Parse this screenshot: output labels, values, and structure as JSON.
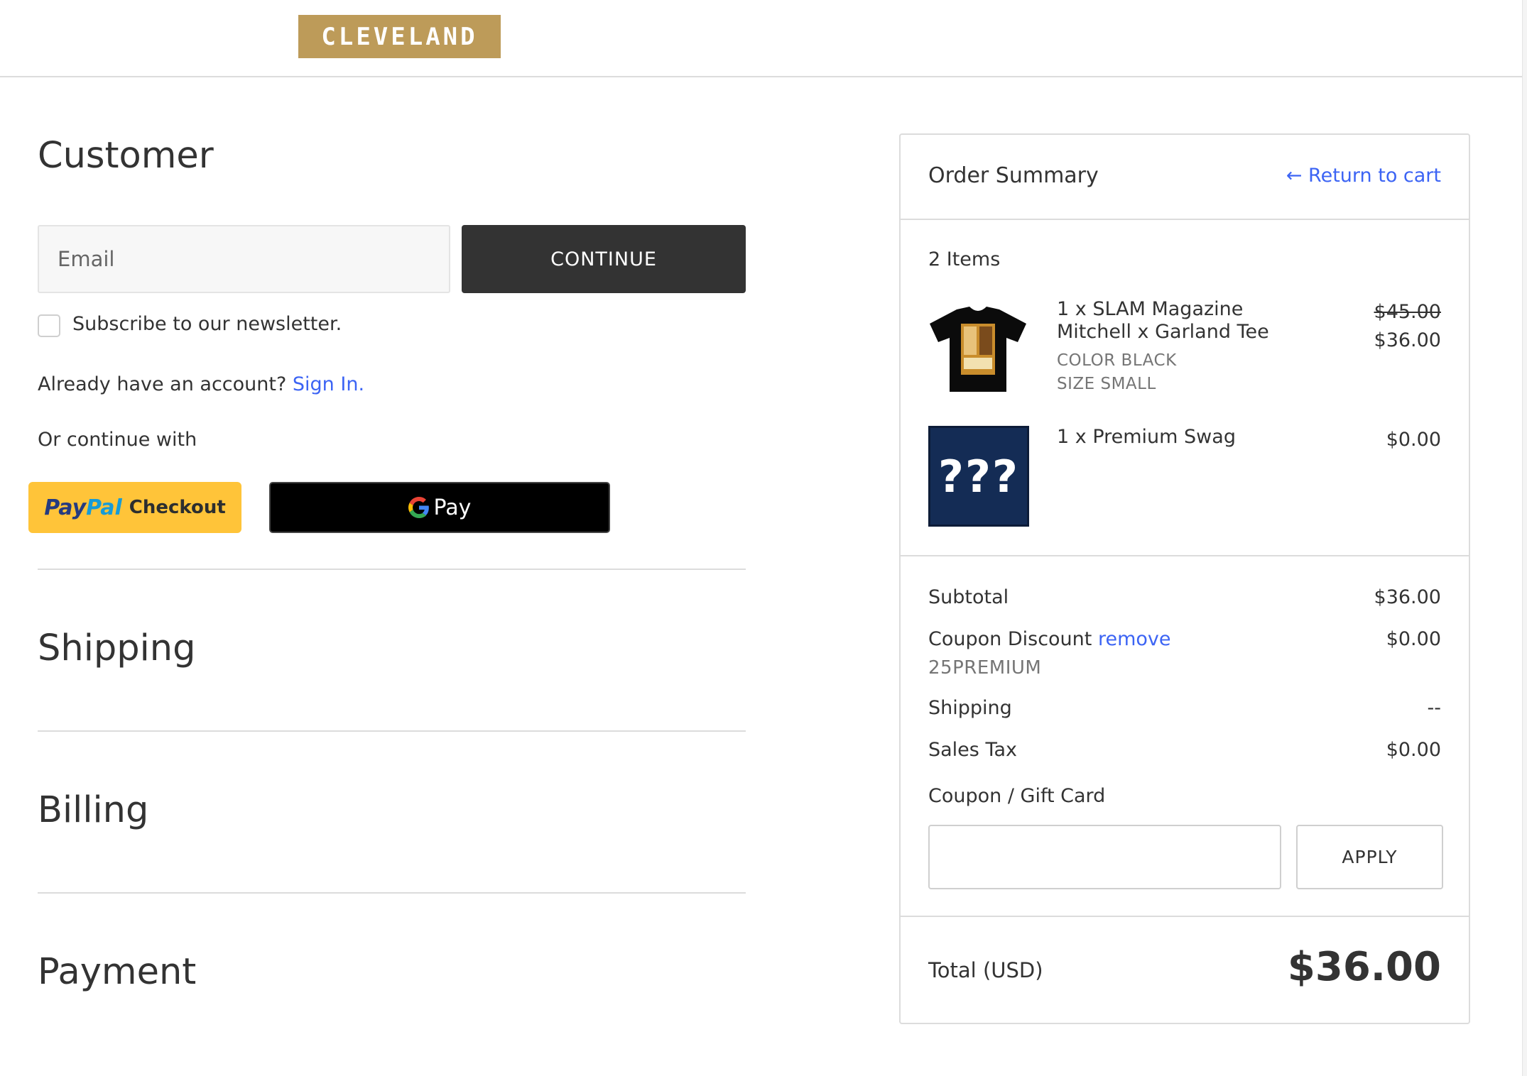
{
  "header": {
    "logo_text": "CLEVELAND"
  },
  "customer": {
    "title": "Customer",
    "email_placeholder": "Email",
    "continue_label": "CONTINUE",
    "newsletter_label": "Subscribe to our newsletter.",
    "account_prompt": "Already have an account?",
    "signin_label": "Sign In.",
    "or_continue": "Or continue with",
    "paypal": {
      "pay": "Pay",
      "pal": "Pal",
      "checkout": "Checkout"
    },
    "gpay_label": "Pay"
  },
  "sections": {
    "shipping": "Shipping",
    "billing": "Billing",
    "payment": "Payment"
  },
  "summary": {
    "title": "Order Summary",
    "return_label": "← Return to cart",
    "items_count": "2 Items",
    "items": [
      {
        "name_line1": "1 x SLAM Magazine",
        "name_line2": "Mitchell x Garland Tee",
        "color": "COLOR BLACK",
        "size": "SIZE SMALL",
        "original_price": "$45.00",
        "price": "$36.00"
      },
      {
        "name_line1": "1 x Premium Swag",
        "thumb_text": "???",
        "price": "$0.00"
      }
    ],
    "subtotal_label": "Subtotal",
    "subtotal_value": "$36.00",
    "coupon_label": "Coupon Discount",
    "coupon_remove": "remove",
    "coupon_code": "25PREMIUM",
    "coupon_value": "$0.00",
    "shipping_label": "Shipping",
    "shipping_value": "--",
    "tax_label": "Sales Tax",
    "tax_value": "$0.00",
    "gift_label": "Coupon / Gift Card",
    "apply_label": "APPLY",
    "total_label": "Total (USD)",
    "total_value": "$36.00"
  },
  "colors": {
    "accent_link": "#3c64f4",
    "logo_bg": "#bd9b59",
    "dark_button": "#333333",
    "paypal_yellow": "#ffc439"
  }
}
